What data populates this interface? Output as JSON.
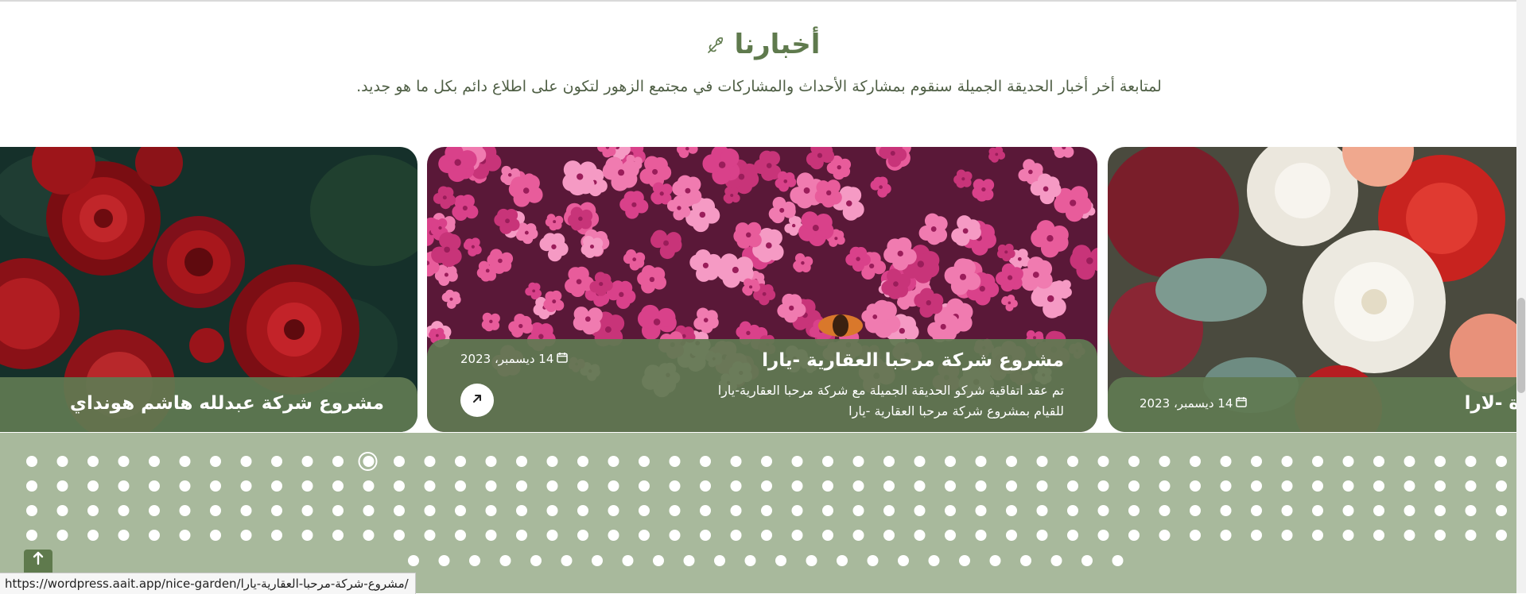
{
  "section": {
    "title": "أخبارنا",
    "subtitle": "لمتابعة أخر أخبار الحديقة الجميلة سنقوم بمشاركة الأحداث والمشاركات في مجتمع الزهور لتكون على اطلاع دائم بكل ما هو جديد."
  },
  "cards": [
    {
      "title": "مشروع شركة عبدلله هاشم هونداي",
      "image": "red-roses"
    },
    {
      "title": "مشروع شركة مرحبا العقارية -يارا",
      "date": "14 ديسمبر، 2023",
      "excerpt": "تم عقد اتفاقية شركو الحديقة الجميلة مع شركة مرحبا العقارية-يارا للقيام بمشروع شركة مرحبا العقارية -يارا",
      "image": "pink-phlox"
    },
    {
      "title": "ة -لارا",
      "date": "14 ديسمبر، 2023",
      "image": "white-red-bouquet"
    }
  ],
  "icons": {
    "title": "flower-icon",
    "date": "calendar-icon",
    "link": "arrow-up-right-icon",
    "scroll_top": "arrow-up-icon"
  },
  "colors": {
    "accent": "#5f7a4d",
    "band": "#a8b99c"
  },
  "status_bar": {
    "url": "https://wordpress.aait.app/nice-garden/مشروع-شركة-مرحبا-العقارية-يارا/"
  }
}
